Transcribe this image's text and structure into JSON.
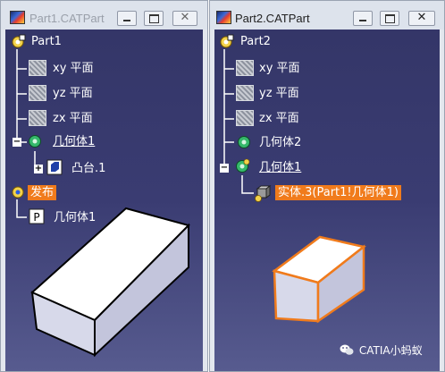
{
  "windows": [
    {
      "title": "Part1.CATPart",
      "active": false,
      "tree": {
        "root": "Part1",
        "planes": [
          "xy 平面",
          "yz 平面",
          "zx 平面"
        ],
        "body": "几何体1",
        "pad": "凸台.1",
        "publication": "发布",
        "published_item": "几何体1"
      }
    },
    {
      "title": "Part2.CATPart",
      "active": true,
      "tree": {
        "root": "Part2",
        "planes": [
          "xy 平面",
          "yz 平面",
          "zx 平面"
        ],
        "body2": "几何体2",
        "body1": "几何体1",
        "solid": "实体.3(Part1!几何体1)"
      }
    }
  ],
  "watermark": "CATIA小蚂蚁",
  "colors": {
    "highlight": "#f07b1c",
    "background_top": "#343668",
    "background_bottom": "#575b8f"
  }
}
